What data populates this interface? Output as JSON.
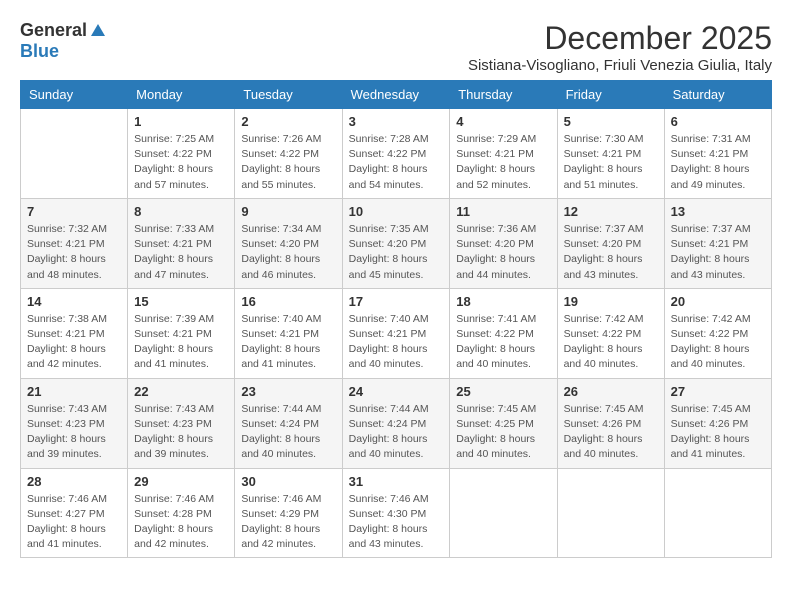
{
  "logo": {
    "general": "General",
    "blue": "Blue"
  },
  "header": {
    "month": "December 2025",
    "location": "Sistiana-Visogliano, Friuli Venezia Giulia, Italy"
  },
  "weekdays": [
    "Sunday",
    "Monday",
    "Tuesday",
    "Wednesday",
    "Thursday",
    "Friday",
    "Saturday"
  ],
  "weeks": [
    [
      {
        "day": "",
        "info": ""
      },
      {
        "day": "1",
        "info": "Sunrise: 7:25 AM\nSunset: 4:22 PM\nDaylight: 8 hours\nand 57 minutes."
      },
      {
        "day": "2",
        "info": "Sunrise: 7:26 AM\nSunset: 4:22 PM\nDaylight: 8 hours\nand 55 minutes."
      },
      {
        "day": "3",
        "info": "Sunrise: 7:28 AM\nSunset: 4:22 PM\nDaylight: 8 hours\nand 54 minutes."
      },
      {
        "day": "4",
        "info": "Sunrise: 7:29 AM\nSunset: 4:21 PM\nDaylight: 8 hours\nand 52 minutes."
      },
      {
        "day": "5",
        "info": "Sunrise: 7:30 AM\nSunset: 4:21 PM\nDaylight: 8 hours\nand 51 minutes."
      },
      {
        "day": "6",
        "info": "Sunrise: 7:31 AM\nSunset: 4:21 PM\nDaylight: 8 hours\nand 49 minutes."
      }
    ],
    [
      {
        "day": "7",
        "info": "Sunrise: 7:32 AM\nSunset: 4:21 PM\nDaylight: 8 hours\nand 48 minutes."
      },
      {
        "day": "8",
        "info": "Sunrise: 7:33 AM\nSunset: 4:21 PM\nDaylight: 8 hours\nand 47 minutes."
      },
      {
        "day": "9",
        "info": "Sunrise: 7:34 AM\nSunset: 4:20 PM\nDaylight: 8 hours\nand 46 minutes."
      },
      {
        "day": "10",
        "info": "Sunrise: 7:35 AM\nSunset: 4:20 PM\nDaylight: 8 hours\nand 45 minutes."
      },
      {
        "day": "11",
        "info": "Sunrise: 7:36 AM\nSunset: 4:20 PM\nDaylight: 8 hours\nand 44 minutes."
      },
      {
        "day": "12",
        "info": "Sunrise: 7:37 AM\nSunset: 4:20 PM\nDaylight: 8 hours\nand 43 minutes."
      },
      {
        "day": "13",
        "info": "Sunrise: 7:37 AM\nSunset: 4:21 PM\nDaylight: 8 hours\nand 43 minutes."
      }
    ],
    [
      {
        "day": "14",
        "info": "Sunrise: 7:38 AM\nSunset: 4:21 PM\nDaylight: 8 hours\nand 42 minutes."
      },
      {
        "day": "15",
        "info": "Sunrise: 7:39 AM\nSunset: 4:21 PM\nDaylight: 8 hours\nand 41 minutes."
      },
      {
        "day": "16",
        "info": "Sunrise: 7:40 AM\nSunset: 4:21 PM\nDaylight: 8 hours\nand 41 minutes."
      },
      {
        "day": "17",
        "info": "Sunrise: 7:40 AM\nSunset: 4:21 PM\nDaylight: 8 hours\nand 40 minutes."
      },
      {
        "day": "18",
        "info": "Sunrise: 7:41 AM\nSunset: 4:22 PM\nDaylight: 8 hours\nand 40 minutes."
      },
      {
        "day": "19",
        "info": "Sunrise: 7:42 AM\nSunset: 4:22 PM\nDaylight: 8 hours\nand 40 minutes."
      },
      {
        "day": "20",
        "info": "Sunrise: 7:42 AM\nSunset: 4:22 PM\nDaylight: 8 hours\nand 40 minutes."
      }
    ],
    [
      {
        "day": "21",
        "info": "Sunrise: 7:43 AM\nSunset: 4:23 PM\nDaylight: 8 hours\nand 39 minutes."
      },
      {
        "day": "22",
        "info": "Sunrise: 7:43 AM\nSunset: 4:23 PM\nDaylight: 8 hours\nand 39 minutes."
      },
      {
        "day": "23",
        "info": "Sunrise: 7:44 AM\nSunset: 4:24 PM\nDaylight: 8 hours\nand 40 minutes."
      },
      {
        "day": "24",
        "info": "Sunrise: 7:44 AM\nSunset: 4:24 PM\nDaylight: 8 hours\nand 40 minutes."
      },
      {
        "day": "25",
        "info": "Sunrise: 7:45 AM\nSunset: 4:25 PM\nDaylight: 8 hours\nand 40 minutes."
      },
      {
        "day": "26",
        "info": "Sunrise: 7:45 AM\nSunset: 4:26 PM\nDaylight: 8 hours\nand 40 minutes."
      },
      {
        "day": "27",
        "info": "Sunrise: 7:45 AM\nSunset: 4:26 PM\nDaylight: 8 hours\nand 41 minutes."
      }
    ],
    [
      {
        "day": "28",
        "info": "Sunrise: 7:46 AM\nSunset: 4:27 PM\nDaylight: 8 hours\nand 41 minutes."
      },
      {
        "day": "29",
        "info": "Sunrise: 7:46 AM\nSunset: 4:28 PM\nDaylight: 8 hours\nand 42 minutes."
      },
      {
        "day": "30",
        "info": "Sunrise: 7:46 AM\nSunset: 4:29 PM\nDaylight: 8 hours\nand 42 minutes."
      },
      {
        "day": "31",
        "info": "Sunrise: 7:46 AM\nSunset: 4:30 PM\nDaylight: 8 hours\nand 43 minutes."
      },
      {
        "day": "",
        "info": ""
      },
      {
        "day": "",
        "info": ""
      },
      {
        "day": "",
        "info": ""
      }
    ]
  ]
}
